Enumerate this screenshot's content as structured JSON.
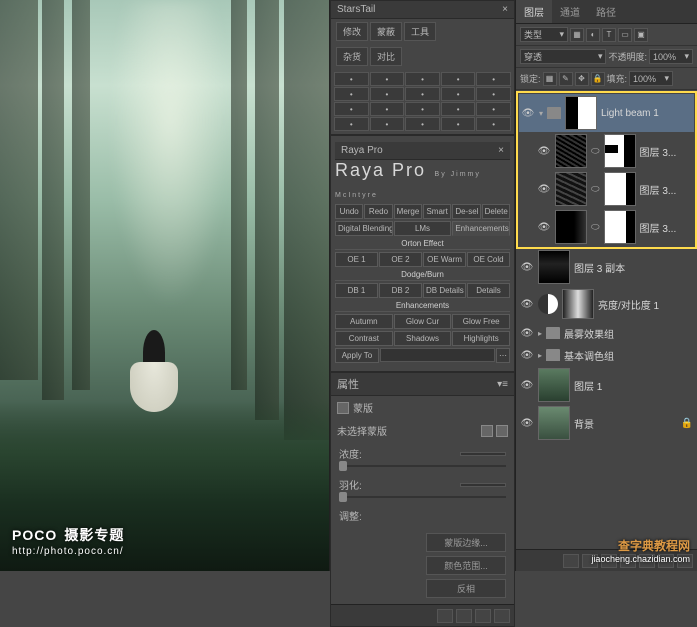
{
  "poco": {
    "logo": "POCO",
    "logo_suffix": "摄影专题",
    "url": "http://photo.poco.cn/"
  },
  "zd": {
    "title": "查字典",
    "suffix": "教程网",
    "url": "jiaocheng.chazidian.com"
  },
  "starstail": {
    "title": "StarsTail",
    "tabs": [
      "修改",
      "蒙蔽",
      "工具",
      "杂货",
      "对比"
    ]
  },
  "raya": {
    "title": "Raya Pro",
    "by": "By Jimmy McIntyre",
    "row1": [
      "Undo",
      "Redo",
      "Merge",
      "Smart",
      "De-sel",
      "Delete"
    ],
    "tabs": [
      "Digital Blending",
      "LMs",
      "Enhancements"
    ],
    "orton": {
      "title": "Orton Effect",
      "btns": [
        "OE 1",
        "OE 2",
        "OE Warm",
        "OE Cold"
      ]
    },
    "dodge": {
      "title": "Dodge/Burn",
      "btns": [
        "DB 1",
        "DB 2",
        "DB Details",
        "Details"
      ]
    },
    "enh": {
      "title": "Enhancements",
      "r1": [
        "Autumn",
        "Glow Cur",
        "Glow Free"
      ],
      "r2": [
        "Contrast",
        "Shadows",
        "Highlights"
      ]
    },
    "apply": "Apply To"
  },
  "prop": {
    "title": "属性",
    "sub": "蒙版",
    "maskname": "未选择蒙版",
    "density_lbl": "浓度:",
    "density_val": "",
    "feather_lbl": "羽化:",
    "feather_val": "",
    "refine_lbl": "调整:",
    "btns": [
      "蒙版边缘...",
      "颜色范围...",
      "反相"
    ]
  },
  "layerspanel": {
    "tabs": [
      "图层",
      "通道",
      "路径"
    ],
    "kind": "类型",
    "blend": "穿透",
    "opacity_lbl": "不透明度:",
    "opacity": "100%",
    "lock_lbl": "锁定:",
    "fill_lbl": "填充:",
    "fill": "100%",
    "layers": [
      {
        "name": "Light beam 1"
      },
      {
        "name": "图层 3..."
      },
      {
        "name": "图层 3..."
      },
      {
        "name": "图层 3..."
      },
      {
        "name": "图层 3 副本"
      },
      {
        "name": "亮度/对比度 1"
      },
      {
        "name": "晨雾效果组"
      },
      {
        "name": "基本调色组"
      },
      {
        "name": "图层 1"
      },
      {
        "name": "背景"
      }
    ]
  }
}
